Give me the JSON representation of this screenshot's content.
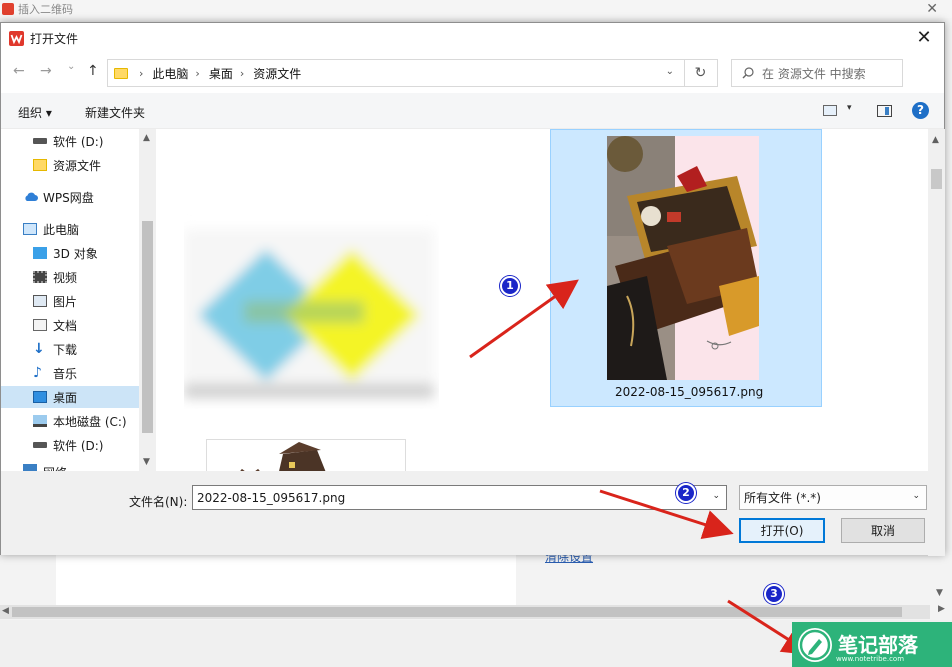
{
  "background_window": {
    "title": "插入二维码",
    "close_glyph": "✕",
    "link_text": "清除设置"
  },
  "dialog": {
    "title": "打开文件",
    "close_glyph": "✕"
  },
  "nav": {
    "back_glyph": "←",
    "forward_glyph": "→",
    "recent_glyph": "⌄",
    "up_glyph": "↑",
    "breadcrumbs": [
      "此电脑",
      "桌面",
      "资源文件"
    ],
    "crumb_sep": "›",
    "dropdown_glyph": "⌄",
    "refresh_glyph": "↻",
    "search_placeholder": "在 资源文件 中搜索"
  },
  "commands": {
    "organize": "组织 ▾",
    "new_folder": "新建文件夹",
    "view_drop": "▾",
    "help": "?"
  },
  "sidebar": {
    "items": [
      {
        "label": "软件 (D:)",
        "icon": "drive-icon"
      },
      {
        "label": "资源文件",
        "icon": "folder-icon"
      },
      {
        "label": "WPS网盘",
        "icon": "cloud-icon"
      },
      {
        "label": "此电脑",
        "icon": "computer-icon"
      },
      {
        "label": "3D 对象",
        "icon": "cube-icon"
      },
      {
        "label": "视频",
        "icon": "video-icon"
      },
      {
        "label": "图片",
        "icon": "picture-icon"
      },
      {
        "label": "文档",
        "icon": "document-icon"
      },
      {
        "label": "下载",
        "icon": "download-icon"
      },
      {
        "label": "音乐",
        "icon": "music-icon"
      },
      {
        "label": "桌面",
        "icon": "desktop-icon",
        "selected": true
      },
      {
        "label": "本地磁盘 (C:)",
        "icon": "disk-icon"
      },
      {
        "label": "软件 (D:)",
        "icon": "drive-icon"
      },
      {
        "label": "网络",
        "icon": "network-icon"
      }
    ],
    "scroll_up": "▲",
    "scroll_down": "▼"
  },
  "files": {
    "selected_file_name": "2022-08-15_095617.png"
  },
  "bottom": {
    "filename_label": "文件名(N):",
    "filename_value": "2022-08-15_095617.png",
    "filename_drop": "⌄",
    "filter_value": "所有文件 (*.*)",
    "filter_drop": "⌄",
    "open_button": "打开(O)",
    "cancel_button": "取消"
  },
  "annotations": {
    "markers": [
      "1",
      "2",
      "3"
    ],
    "arrow_color": "#d9241b",
    "marker_color": "#1a26c8"
  },
  "watermark": {
    "text": "笔记部落",
    "url": "www.notetribe.com"
  },
  "colors": {
    "selection": "#cce8ff",
    "selection_border": "#99d1ff",
    "primary_border": "#0078d7",
    "watermark_green": "#2db37a"
  }
}
